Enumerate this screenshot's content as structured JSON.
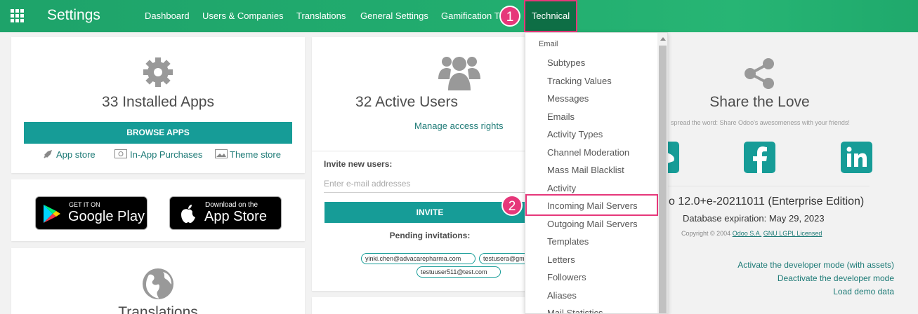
{
  "app": {
    "title": "Settings",
    "menu": [
      "Dashboard",
      "Users & Companies",
      "Translations",
      "General Settings",
      "Gamification T",
      "Technical"
    ]
  },
  "markers": [
    "1",
    "2"
  ],
  "apps_card": {
    "title": "33 Installed Apps",
    "browse_button": "BROWSE APPS",
    "links": [
      "App store",
      "In-App Purchases",
      "Theme store"
    ]
  },
  "stores": {
    "google_small": "GET IT ON",
    "google_large": "Google Play",
    "apple_small": "Download on the",
    "apple_large": "App Store"
  },
  "translations_card": {
    "title": "Translations"
  },
  "users_card": {
    "title": "32 Active Users",
    "manage_link": "Manage access rights",
    "invite_label": "Invite new users:",
    "invite_placeholder": "Enter e-mail addresses",
    "invite_button": "INVITE",
    "pending_label": "Pending invitations:",
    "pending": [
      "yinki.chen@advacarepharma.com",
      "testusera@gmail.com",
      "testuuser511@test.com"
    ]
  },
  "dropdown": {
    "header": "Email",
    "items": [
      "Subtypes",
      "Tracking Values",
      "Messages",
      "Emails",
      "Activity Types",
      "Channel Moderation",
      "Mass Mail Blacklist",
      "Activity",
      "Incoming Mail Servers",
      "Outgoing Mail Servers",
      "Templates",
      "Letters",
      "Followers",
      "Aliases",
      "Mail Statistics"
    ]
  },
  "share_card": {
    "title": "Share the Love",
    "subtitle": "spread the word: Share Odoo's awesomeness with your friends!",
    "version": "o 12.0+e-20211011 (Enterprise Edition)",
    "expiration": "Database expiration: May 29, 2023",
    "copyright_prefix": "Copyright © 2004",
    "copyright_company": "Odoo S.A.",
    "copyright_license": "GNU LGPL Licensed"
  },
  "dev_links": [
    "Activate the developer mode (with assets)",
    "Deactivate the developer mode",
    "Load demo data"
  ],
  "colors": {
    "primary_green": "#22ad6f",
    "teal": "#169c97",
    "highlight": "#e6377a",
    "active_menu": "#0e6e45"
  }
}
